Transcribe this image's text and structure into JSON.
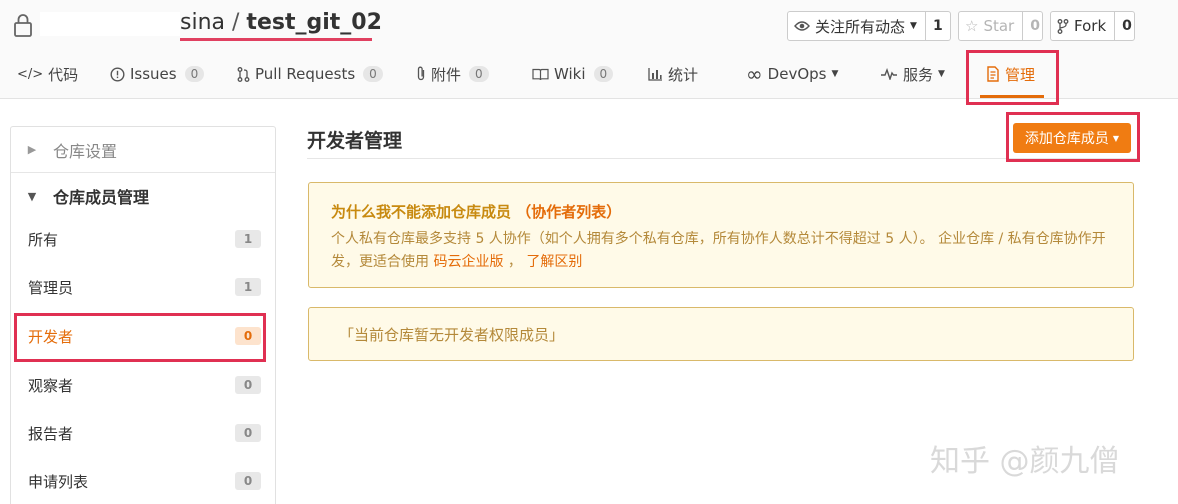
{
  "header": {
    "owner_suffix": "sina",
    "separator": "/",
    "repo_name": "test_git_02",
    "watch_label": "关注所有动态",
    "watch_count": "1",
    "star_label": "Star",
    "star_count": "0",
    "fork_label": "Fork",
    "fork_count": "0"
  },
  "tabs": [
    {
      "label": "代码",
      "icon": "code-icon"
    },
    {
      "label": "Issues",
      "badge": "0",
      "icon": "issue-icon"
    },
    {
      "label": "Pull Requests",
      "badge": "0",
      "icon": "pull-request-icon"
    },
    {
      "label": "附件",
      "badge": "0",
      "icon": "paperclip-icon"
    },
    {
      "label": "Wiki",
      "badge": "0",
      "icon": "book-icon"
    },
    {
      "label": "统计",
      "icon": "bar-chart-icon"
    },
    {
      "label": "DevOps",
      "icon": "infinity-icon"
    },
    {
      "label": "服务",
      "icon": "pulse-icon"
    },
    {
      "label": "管理",
      "icon": "settings-doc-icon"
    }
  ],
  "sidebar": {
    "section_repo_settings": "仓库设置",
    "section_members": "仓库成员管理",
    "items": [
      {
        "label": "所有",
        "count": "1"
      },
      {
        "label": "管理员",
        "count": "1"
      },
      {
        "label": "开发者",
        "count": "0"
      },
      {
        "label": "观察者",
        "count": "0"
      },
      {
        "label": "报告者",
        "count": "0"
      },
      {
        "label": "申请列表",
        "count": "0"
      }
    ]
  },
  "main": {
    "title": "开发者管理",
    "add_button": "添加仓库成员",
    "notice_title": "为什么我不能添加仓库成员",
    "notice_link_title": "（协作者列表）",
    "notice_body_1": "个人私有仓库最多支持 5 人协作（如个人拥有多个私有仓库，所有协作人数总计不得超过 5 人）。 企业仓库 / 私有仓库协作开发，更适合使用 ",
    "notice_link_enterprise": "码云企业版",
    "notice_comma": " ，",
    "notice_link_diff": "了解区别",
    "empty_text": "「当前仓库暂无开发者权限成员」"
  },
  "watermark": "知乎 @颜九僧",
  "colors": {
    "accent": "#e46c0a",
    "button": "#f07c12",
    "highlight_box": "#e03052",
    "notice_bg": "#fffae8"
  }
}
